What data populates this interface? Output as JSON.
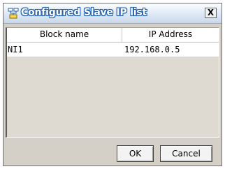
{
  "window": {
    "title": "Configured Slave IP list",
    "app_icon": "network-app-icon",
    "close_glyph": "X",
    "title_color": "#1e5fb0"
  },
  "table": {
    "columns": [
      "Block name",
      "IP Address"
    ],
    "rows": [
      {
        "block_name": "NI1",
        "ip_address": "192.168.0.5"
      }
    ]
  },
  "buttons": {
    "ok_label": "OK",
    "cancel_label": "Cancel"
  }
}
